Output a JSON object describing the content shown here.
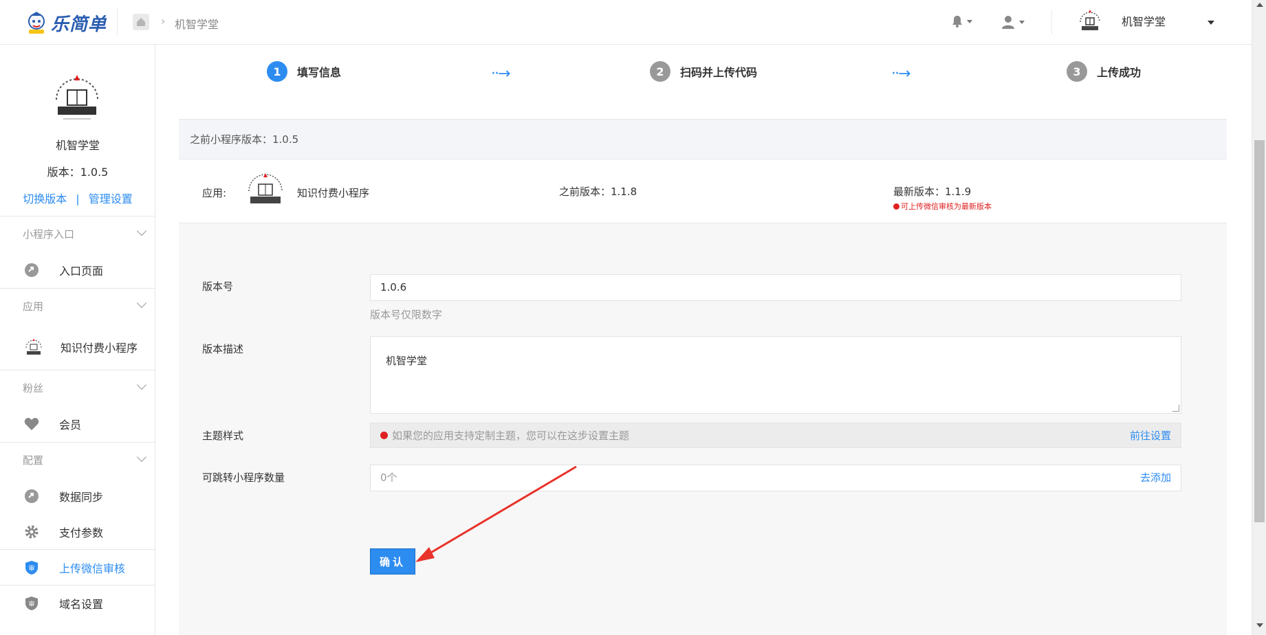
{
  "header": {
    "logo_text": "乐简单",
    "breadcrumb": "机智学堂",
    "account_name": "机智学堂"
  },
  "sidebar": {
    "profile_name": "机智学堂",
    "version": "版本：1.0.5",
    "switch_version": "切换版本",
    "link_sep": "|",
    "manage_settings": "管理设置",
    "groups": [
      {
        "title": "小程序入口",
        "items": [
          {
            "label": "入口页面",
            "icon": "link-icon"
          }
        ]
      },
      {
        "title": "应用",
        "items": [
          {
            "label": "知识付费小程序",
            "icon": "app-badge-icon"
          }
        ]
      },
      {
        "title": "粉丝",
        "items": [
          {
            "label": "会员",
            "icon": "heart-icon"
          }
        ]
      },
      {
        "title": "配置",
        "items": [
          {
            "label": "数据同步",
            "icon": "link-icon"
          },
          {
            "label": "支付参数",
            "icon": "gear-icon"
          },
          {
            "label": "上传微信审核",
            "icon": "shield-icon",
            "active": true
          },
          {
            "label": "域名设置",
            "icon": "shield-icon"
          }
        ]
      }
    ]
  },
  "steps": [
    {
      "num": "1",
      "label": "填写信息",
      "color": "#2d8cf0"
    },
    {
      "num": "2",
      "label": "扫码并上传代码",
      "color": "#999999"
    },
    {
      "num": "3",
      "label": "上传成功",
      "color": "#999999"
    }
  ],
  "notice": "之前小程序版本：1.0.5",
  "app_row": {
    "label": "应用:",
    "app_name": "知识付费小程序",
    "prev_version": "之前版本：1.1.8",
    "latest_version": "最新版本：1.1.9",
    "latest_warning": "可上传微信审核为最新版本"
  },
  "form": {
    "version_label": "版本号",
    "version_value": "1.0.6",
    "version_hint": "版本号仅限数字",
    "desc_label": "版本描述",
    "desc_value": "机智学堂",
    "theme_label": "主题样式",
    "theme_text": "如果您的应用支持定制主题，您可以在这步设置主题",
    "theme_link": "前往设置",
    "jump_label": "可跳转小程序数量",
    "jump_value": "0个",
    "jump_link": "去添加",
    "confirm": "确认"
  },
  "colors": {
    "accent": "#2d8cf0",
    "warning": "#e02020",
    "annotation_arrow": "#e8332a"
  }
}
